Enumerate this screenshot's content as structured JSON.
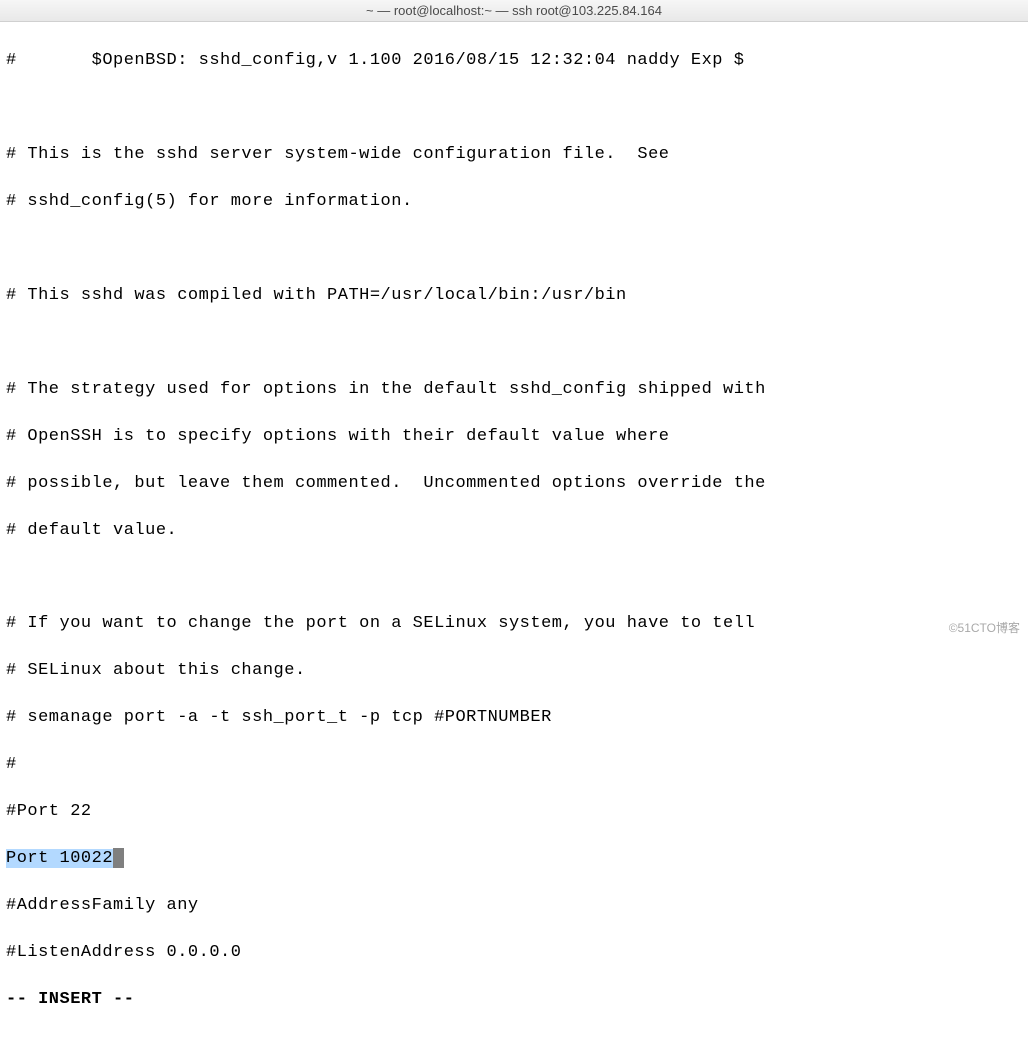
{
  "window": {
    "title": "~ — root@localhost:~ — ssh root@103.225.84.164"
  },
  "lines": {
    "l0": "#       $OpenBSD: sshd_config,v 1.100 2016/08/15 12:32:04 naddy Exp $",
    "l1": "",
    "l2": "# This is the sshd server system-wide configuration file.  See",
    "l3": "# sshd_config(5) for more information.",
    "l4": "",
    "l5": "# This sshd was compiled with PATH=/usr/local/bin:/usr/bin",
    "l6": "",
    "l7": "# The strategy used for options in the default sshd_config shipped with",
    "l8": "# OpenSSH is to specify options with their default value where",
    "l9": "# possible, but leave them commented.  Uncommented options override the",
    "l10": "# default value.",
    "l11": "",
    "l12": "# If you want to change the port on a SELinux system, you have to tell",
    "l13": "# SELinux about this change.",
    "l14": "# semanage port -a -t ssh_port_t -p tcp #PORTNUMBER",
    "l15": "#",
    "l16": "#Port 22",
    "l17_highlight": "Port 10022",
    "l18": "#AddressFamily any",
    "l19": "#ListenAddress 0.0.0.0"
  },
  "status": {
    "mode": "-- INSERT --"
  },
  "watermark": "©51CTO博客"
}
